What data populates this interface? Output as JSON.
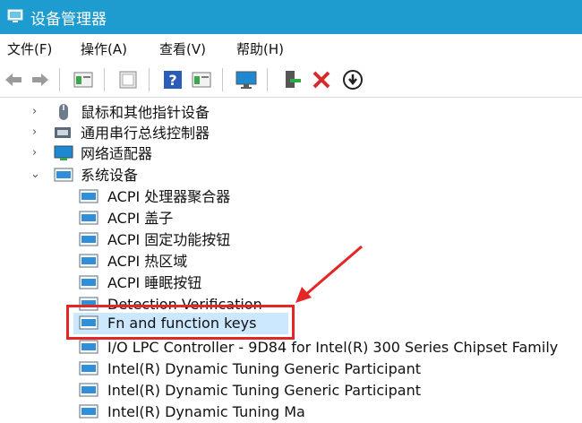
{
  "window": {
    "title": "设备管理器"
  },
  "menu": [
    "文件(F)",
    "操作(A)",
    "查看(V)",
    "帮助(H)"
  ],
  "toolbar": {
    "buttons": [
      "back-icon",
      "forward-icon",
      "properties-icon",
      "show-hidden-icon",
      "help-icon",
      "update-driver-icon",
      "scan-hardware-icon",
      "add-legacy-icon",
      "uninstall-icon",
      "enable-device-icon"
    ]
  },
  "tree": {
    "categories": [
      {
        "label": "鼠标和其他指针设备",
        "expanded": false
      },
      {
        "label": "通用串行总线控制器",
        "expanded": false
      },
      {
        "label": "网络适配器",
        "expanded": false
      },
      {
        "label": "系统设备",
        "expanded": true
      }
    ],
    "devices": [
      "ACPI 处理器聚合器",
      "ACPI 盖子",
      "ACPI 固定功能按钮",
      "ACPI 热区域",
      "ACPI 睡眠按钮",
      "Detection Verification",
      "Fn and function keys",
      "I/O LPC Controller - 9D84 for Intel(R) 300 Series Chipset Family",
      "Intel(R) Dynamic Tuning Generic Participant",
      "Intel(R) Dynamic Tuning Generic Participant",
      "Intel(R) Dynamic Tuning Ma"
    ],
    "selected_device": "Fn and function keys"
  },
  "colors": {
    "titlebar": "#1e9bcf",
    "selection": "#cce8ff",
    "annotation": "#e32626"
  }
}
